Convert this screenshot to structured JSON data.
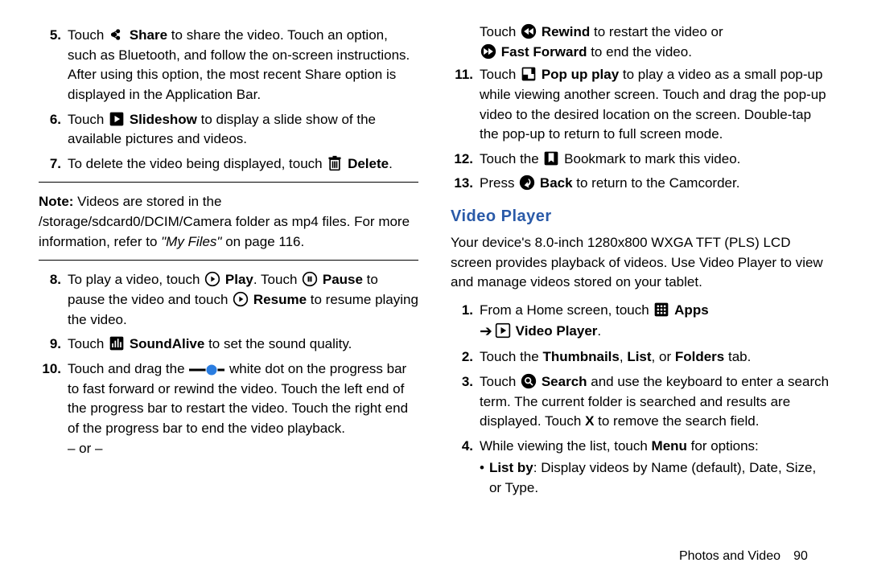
{
  "left": {
    "steps_a": [
      {
        "n": "5.",
        "a": "Touch ",
        "icon": "share",
        "b": " ",
        "bold1": "Share",
        "c": " to share the video. Touch an option, such as Bluetooth, and follow the on-screen instructions. After using this option, the most recent Share option is displayed in the Application Bar."
      },
      {
        "n": "6.",
        "a": "Touch ",
        "icon": "slideshow",
        "b": " ",
        "bold1": "Slideshow",
        "c": " to display a slide show of the available pictures and videos."
      },
      {
        "n": "7.",
        "a": "To delete the video being displayed, touch ",
        "icon": "delete",
        "b": " ",
        "bold1": "Delete",
        "c": "."
      }
    ],
    "note_label": "Note:",
    "note_text_1": " Videos are stored in the /storage/sdcard0/DCIM/Camera folder as mp4 files. For more information, refer to ",
    "note_italic": "\"My Files\"",
    "note_text_2": " on page 116.",
    "steps_b": {
      "8": {
        "n": "8.",
        "a": "To play a video, touch ",
        "icon1": "play-circle",
        "b": " ",
        "bold1": "Play",
        "c": ". Touch ",
        "icon2": "pause-circle",
        "d": " ",
        "bold2": "Pause",
        "e": " to pause the video and touch ",
        "icon3": "play-circle",
        "f": " ",
        "bold3": "Resume",
        "g": " to resume playing the video."
      },
      "9": {
        "n": "9.",
        "a": "Touch ",
        "icon": "soundalive",
        "b": " ",
        "bold1": "SoundAlive",
        "c": " to set the sound quality."
      },
      "10": {
        "n": "10.",
        "a": "Touch and drag the ",
        "icon": "progress-dot",
        "b": " white dot on the progress bar to fast forward or rewind the video. Touch the left end of the progress bar to restart the video. Touch the right end of the progress bar to end the video playback.",
        "or": "– or –"
      }
    }
  },
  "right": {
    "cont": {
      "a": "Touch ",
      "icon1": "rewind",
      "b": " ",
      "bold1": "Rewind",
      "c": " to restart the video or ",
      "icon2": "fast-forward",
      "d": " ",
      "bold2": "Fast Forward",
      "e": " to end the video."
    },
    "11": {
      "n": "11.",
      "a": "Touch ",
      "icon": "popup",
      "b": " ",
      "bold1": "Pop up play",
      "c": " to play a video as a small pop-up while viewing another screen. Touch and drag the pop-up video to the desired location on the screen. Double-tap the pop-up to return to full screen mode."
    },
    "12": {
      "n": "12.",
      "a": "Touch the ",
      "icon": "bookmark",
      "b": " Bookmark to mark this video."
    },
    "13": {
      "n": "13.",
      "a": "Press ",
      "icon": "back",
      "b": " ",
      "bold1": "Back",
      "c": " to return to the Camcorder."
    },
    "section": "Video Player",
    "intro": "Your device's 8.0-inch 1280x800 WXGA TFT (PLS) LCD screen provides playback of videos. Use Video Player to view and manage videos stored on your tablet.",
    "steps": {
      "1": {
        "n": "1.",
        "a": "From a Home screen, touch ",
        "icon1": "apps",
        "b": " ",
        "bold1": "Apps",
        "arrow": "➔",
        "icon2": "video-player",
        "c": " ",
        "bold2": "Video Player",
        "d": "."
      },
      "2": {
        "n": "2.",
        "a": "Touch the ",
        "bold1": "Thumbnails",
        "b": ", ",
        "bold2": "List",
        "c": ", or ",
        "bold3": "Folders",
        "d": " tab."
      },
      "3": {
        "n": "3.",
        "a": "Touch ",
        "icon": "search",
        "b": " ",
        "bold1": "Search",
        "c": " and use the keyboard to enter a search term. The current folder is searched and results are displayed. Touch ",
        "bold2": "X",
        "d": " to remove the search field."
      },
      "4": {
        "n": "4.",
        "a": "While viewing the list, touch ",
        "bold1": "Menu",
        "b": " for options:",
        "bullet_bold": "List by",
        "bullet_rest": ": Display videos by Name (default), Date, Size, or Type."
      }
    }
  },
  "footer": {
    "section": "Photos and Video",
    "page": "90"
  }
}
